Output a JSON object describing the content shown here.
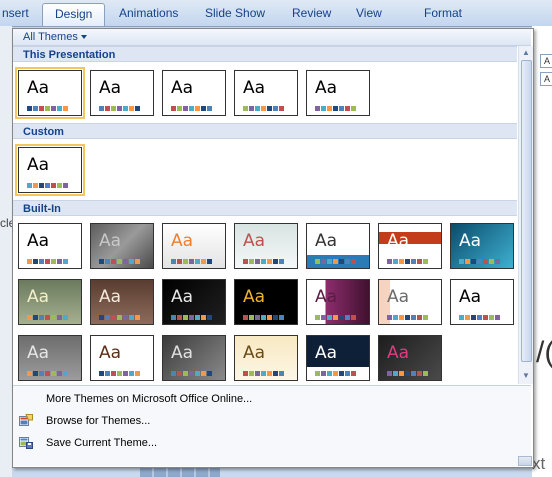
{
  "ribbon": {
    "tabs": [
      {
        "label": "nsert"
      },
      {
        "label": "Design"
      },
      {
        "label": "Animations"
      },
      {
        "label": "Slide Show"
      },
      {
        "label": "Review"
      },
      {
        "label": "View"
      },
      {
        "label": "Format"
      }
    ]
  },
  "background": {
    "left_fragment": "cle",
    "right_fragment_1": "/(",
    "right_fragment_2": "xt",
    "mini_letters": [
      "A",
      "A"
    ]
  },
  "gallery": {
    "filter_label": "All Themes",
    "sections": [
      {
        "title": "This Presentation"
      },
      {
        "title": "Custom"
      },
      {
        "title": "Built-In"
      }
    ],
    "thumb_text": "Aa",
    "menu": [
      {
        "label": "More Themes on Microsoft Office Online...",
        "icon": "none"
      },
      {
        "label": "Browse for Themes...",
        "icon": "browse-icon"
      },
      {
        "label": "Save Current Theme...",
        "icon": "save-theme-icon"
      }
    ]
  }
}
